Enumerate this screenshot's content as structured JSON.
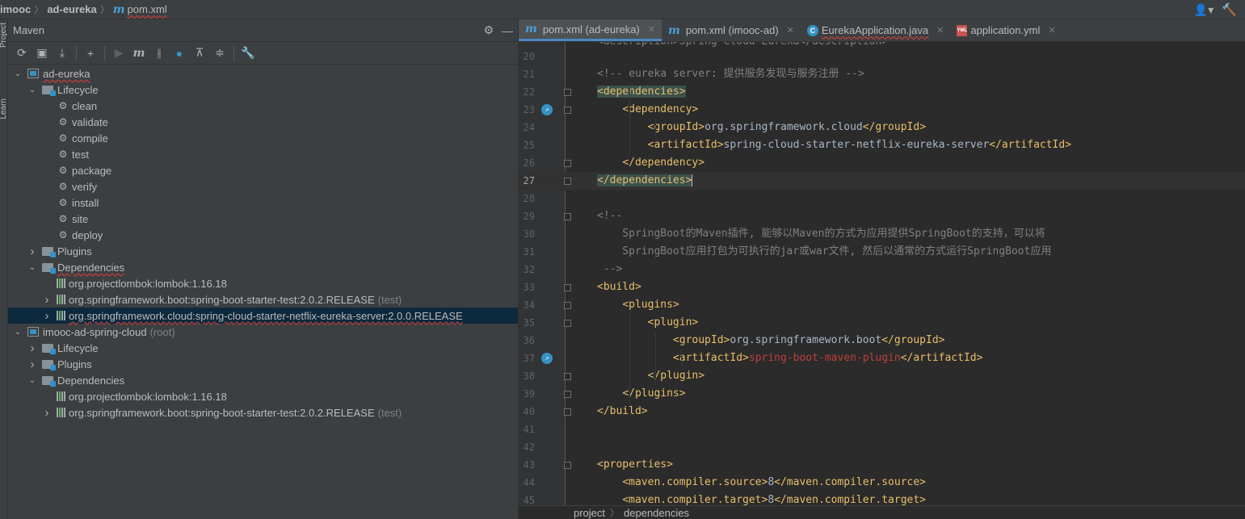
{
  "breadcrumb": {
    "items": [
      "imooc",
      "ad-eureka",
      "pom.xml"
    ]
  },
  "side_strip": {
    "project_label": "Project",
    "learn_label": "Learn"
  },
  "maven": {
    "title": "Maven",
    "toolbar": [
      "reload-icon",
      "generate-sources-icon",
      "download-icon",
      "add-icon",
      "run-icon",
      "maven-goal-icon",
      "toggle-offline-icon",
      "skip-tests-icon",
      "show-dependencies-icon",
      "collapse-all-icon",
      "settings-wrench-icon"
    ],
    "tree": [
      {
        "label": "ad-eureka",
        "kind": "module",
        "depth": 0,
        "expanded": true,
        "squiggle": true
      },
      {
        "label": "Lifecycle",
        "kind": "folder",
        "depth": 1,
        "expanded": true
      },
      {
        "label": "clean",
        "kind": "goal",
        "depth": 2
      },
      {
        "label": "validate",
        "kind": "goal",
        "depth": 2
      },
      {
        "label": "compile",
        "kind": "goal",
        "depth": 2
      },
      {
        "label": "test",
        "kind": "goal",
        "depth": 2
      },
      {
        "label": "package",
        "kind": "goal",
        "depth": 2
      },
      {
        "label": "verify",
        "kind": "goal",
        "depth": 2
      },
      {
        "label": "install",
        "kind": "goal",
        "depth": 2
      },
      {
        "label": "site",
        "kind": "goal",
        "depth": 2
      },
      {
        "label": "deploy",
        "kind": "goal",
        "depth": 2
      },
      {
        "label": "Plugins",
        "kind": "folder",
        "depth": 1,
        "expanded": false
      },
      {
        "label": "Dependencies",
        "kind": "folder",
        "depth": 1,
        "expanded": true,
        "squiggle": true
      },
      {
        "label": "org.projectlombok:lombok:1.16.18",
        "kind": "dep",
        "depth": 2,
        "leaf": true
      },
      {
        "label": "org.springframework.boot:spring-boot-starter-test:2.0.2.RELEASE",
        "kind": "dep",
        "depth": 2,
        "suffix": "(test)",
        "expanded": false
      },
      {
        "label": "org.springframework.cloud:spring-cloud-starter-netflix-eureka-server:2.0.0.RELEASE",
        "kind": "dep",
        "depth": 2,
        "expanded": false,
        "selected": true,
        "squiggle": true
      },
      {
        "label": "imooc-ad-spring-cloud",
        "kind": "module",
        "depth": 0,
        "expanded": true,
        "suffix": "(root)"
      },
      {
        "label": "Lifecycle",
        "kind": "folder",
        "depth": 1,
        "expanded": false
      },
      {
        "label": "Plugins",
        "kind": "folder",
        "depth": 1,
        "expanded": false
      },
      {
        "label": "Dependencies",
        "kind": "folder",
        "depth": 1,
        "expanded": true
      },
      {
        "label": "org.projectlombok:lombok:1.16.18",
        "kind": "dep",
        "depth": 2,
        "leaf": true
      },
      {
        "label": "org.springframework.boot:spring-boot-starter-test:2.0.2.RELEASE",
        "kind": "dep",
        "depth": 2,
        "suffix": "(test)",
        "expanded": false
      }
    ]
  },
  "editor": {
    "tabs": [
      {
        "label": "pom.xml (ad-eureka)",
        "icon": "maven-m-icon",
        "active": true
      },
      {
        "label": "pom.xml (imooc-ad)",
        "icon": "maven-m-icon",
        "active": false
      },
      {
        "label": "EurekaApplication.java",
        "icon": "class-icon",
        "active": false,
        "squiggle": true
      },
      {
        "label": "application.yml",
        "icon": "yml-icon",
        "active": false
      }
    ],
    "top_partial": "<description>Spring Cloud Eureka</description>",
    "lines": [
      {
        "n": "20",
        "html": ""
      },
      {
        "n": "21",
        "html": "<span class='cm'>&lt;!-- eureka server: 提供服务发现与服务注册 --&gt;</span>"
      },
      {
        "n": "22",
        "html": "<span class='hl'>&lt;dependencies&gt;</span>"
      },
      {
        "n": "23",
        "html": "    <span class='t'>&lt;dependency&gt;</span>"
      },
      {
        "n": "24",
        "html": "        <span class='t'>&lt;groupId&gt;</span><span class='v'>org.springframework.cloud</span><span class='t'>&lt;/groupId&gt;</span>"
      },
      {
        "n": "25",
        "html": "        <span class='t'>&lt;artifactId&gt;</span><span class='v'>spring-cloud-starter-netflix-eureka-server</span><span class='t'>&lt;/artifactId&gt;</span>"
      },
      {
        "n": "26",
        "html": "    <span class='t'>&lt;/dependency&gt;</span>"
      },
      {
        "n": "27",
        "html": "<span class='hl'>&lt;/dependencies&gt;</span><span class='caret'></span>",
        "cur": true
      },
      {
        "n": "28",
        "html": ""
      },
      {
        "n": "29",
        "html": "<span class='cm'>&lt;!--</span>"
      },
      {
        "n": "30",
        "html": "<span class='cm'>    SpringBoot的Maven插件, 能够以Maven的方式为应用提供SpringBoot的支持，可以将</span>"
      },
      {
        "n": "31",
        "html": "<span class='cm'>    SpringBoot应用打包为可执行的jar或war文件, 然后以通常的方式运行SpringBoot应用</span>"
      },
      {
        "n": "32",
        "html": "<span class='cm'> --&gt;</span>"
      },
      {
        "n": "33",
        "html": "<span class='t'>&lt;build&gt;</span>"
      },
      {
        "n": "34",
        "html": "    <span class='t'>&lt;plugins&gt;</span>"
      },
      {
        "n": "35",
        "html": "        <span class='t'>&lt;plugin&gt;</span>"
      },
      {
        "n": "36",
        "html": "            <span class='t'>&lt;groupId&gt;</span><span class='v'>org.springframework.boot</span><span class='t'>&lt;/groupId&gt;</span>"
      },
      {
        "n": "37",
        "html": "            <span class='t'>&lt;artifactId&gt;</span><span class='red'>spring-boot-maven-plugin</span><span class='t'>&lt;/artifactId&gt;</span>"
      },
      {
        "n": "38",
        "html": "        <span class='t'>&lt;/plugin&gt;</span>"
      },
      {
        "n": "39",
        "html": "    <span class='t'>&lt;/plugins&gt;</span>"
      },
      {
        "n": "40",
        "html": "<span class='t'>&lt;/build&gt;</span>"
      },
      {
        "n": "41",
        "html": ""
      },
      {
        "n": "42",
        "html": ""
      },
      {
        "n": "43",
        "html": "<span class='t'>&lt;properties&gt;</span>"
      },
      {
        "n": "44",
        "html": "    <span class='t'>&lt;maven.compiler.source&gt;</span><span class='v'>8</span><span class='t'>&lt;/maven.compiler.source&gt;</span>"
      },
      {
        "n": "45",
        "html": "    <span class='t'>&lt;maven.compiler.target&gt;</span><span class='v'>8</span><span class='t'>&lt;/maven.compiler.target&gt;</span>"
      }
    ],
    "gutter_marks": [
      "23",
      "37"
    ],
    "fold_marks": [
      "22",
      "23",
      "26",
      "27",
      "29",
      "33",
      "34",
      "35",
      "38",
      "39",
      "40",
      "43"
    ],
    "status_breadcrumb": [
      "project",
      "dependencies"
    ]
  }
}
